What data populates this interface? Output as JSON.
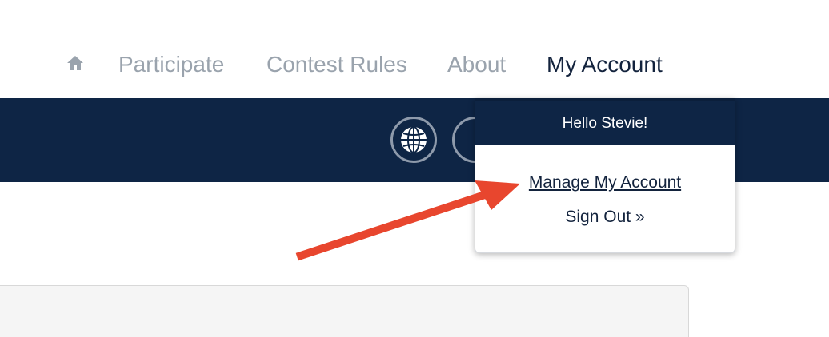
{
  "nav": {
    "home_icon": "home-icon",
    "items": [
      {
        "label": "Participate"
      },
      {
        "label": "Contest Rules"
      },
      {
        "label": "About"
      },
      {
        "label": "My Account"
      }
    ]
  },
  "band": {
    "buttons": [
      {
        "icon": "globe-icon"
      },
      {
        "icon": "circle-button"
      }
    ]
  },
  "dropdown": {
    "greeting": "Hello Stevie!",
    "items": [
      {
        "label": "Manage My Account"
      },
      {
        "label": "Sign Out »"
      }
    ]
  },
  "colors": {
    "navy": "#0e2545",
    "nav_inactive": "#9aa3ad",
    "nav_active": "#13233d",
    "annotation_arrow": "#e8462e"
  }
}
